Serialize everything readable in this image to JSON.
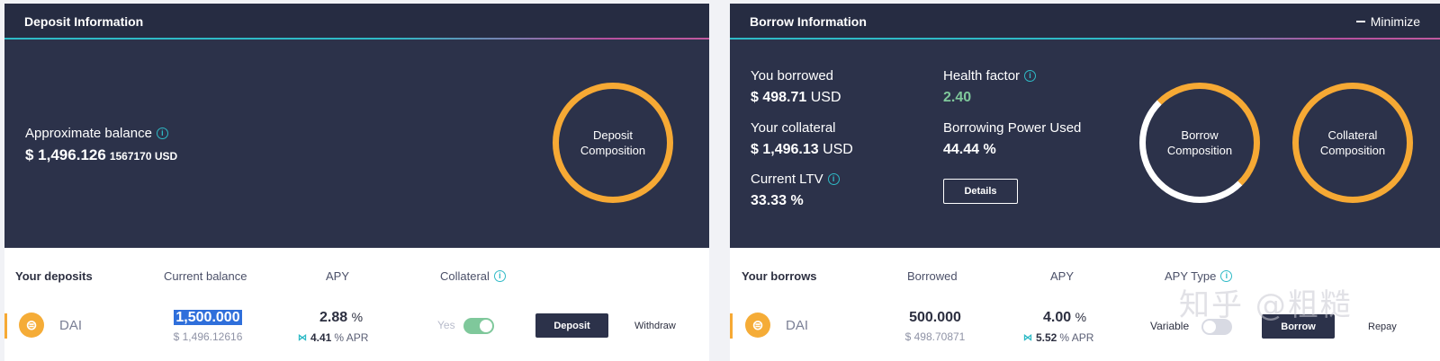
{
  "deposit_panel": {
    "title": "Deposit Information",
    "approx_label": "Approximate balance",
    "approx_value": "$ 1,496.126",
    "approx_value_small": "1567170 USD",
    "donut_label": "Deposit Composition"
  },
  "borrow_panel": {
    "title": "Borrow Information",
    "minimize_label": "Minimize",
    "you_borrowed_label": "You borrowed",
    "you_borrowed_value": "$ 498.71",
    "you_borrowed_unit": "USD",
    "collateral_label": "Your collateral",
    "collateral_value": "$ 1,496.13",
    "collateral_unit": "USD",
    "ltv_label": "Current LTV",
    "ltv_value": "33.33 %",
    "health_label": "Health factor",
    "health_value": "2.40",
    "power_label": "Borrowing Power Used",
    "power_value": "44.44 %",
    "details_label": "Details",
    "borrow_donut_label": "Borrow Composition",
    "collateral_donut_label": "Collateral Composition"
  },
  "deposits_table": {
    "headers": [
      "Your deposits",
      "Current balance",
      "APY",
      "Collateral"
    ],
    "row": {
      "asset": "DAI",
      "balance": "1,500.000",
      "balance_usd": "$ 1,496.12616",
      "apy": "2.88",
      "apy_unit": "%",
      "apr": "4.41",
      "apr_unit": "% APR",
      "collateral_label": "Yes",
      "collateral_on": true,
      "deposit_label": "Deposit",
      "withdraw_label": "Withdraw"
    }
  },
  "borrows_table": {
    "headers": [
      "Your borrows",
      "Borrowed",
      "APY",
      "APY Type"
    ],
    "row": {
      "asset": "DAI",
      "borrowed": "500.000",
      "borrowed_usd": "$ 498.70871",
      "apy": "4.00",
      "apy_unit": "%",
      "apr": "5.52",
      "apr_unit": "% APR",
      "type_label": "Variable",
      "borrow_label": "Borrow",
      "repay_label": "Repay"
    }
  },
  "watermark": "知乎 @粗糙",
  "colors": {
    "panel_bg": "#2c324a",
    "accent_orange": "#f6a934",
    "accent_teal": "#2ebac6",
    "health_green": "#7fc89b"
  }
}
